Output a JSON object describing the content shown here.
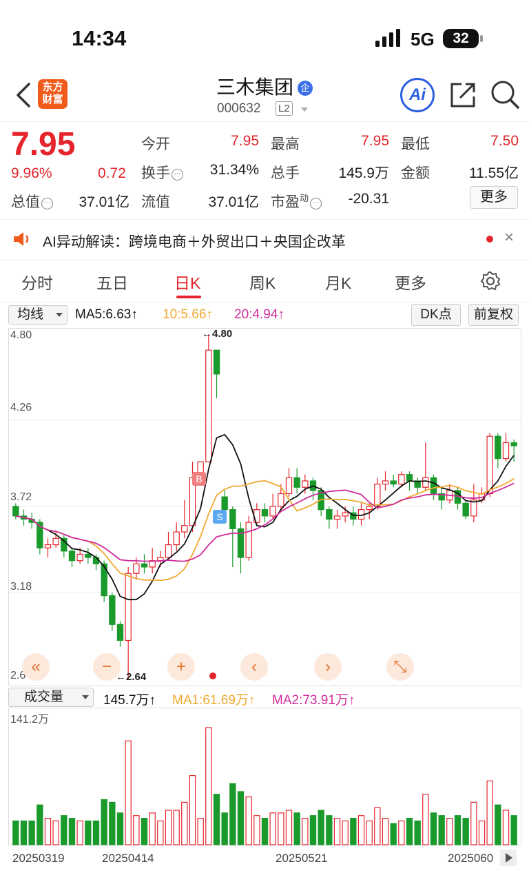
{
  "status": {
    "time": "14:34",
    "network": "5G",
    "battery": "32"
  },
  "header": {
    "logo_line1": "东方",
    "logo_line2": "财富",
    "title": "三木集团",
    "badge": "企",
    "code": "000632",
    "level": "L2",
    "ai_label": "Ai"
  },
  "quote": {
    "price": "7.95",
    "pct": "9.96%",
    "change": "0.72",
    "open_label": "今开",
    "open": "7.95",
    "high_label": "最高",
    "high": "7.95",
    "low_label": "最低",
    "low": "7.50",
    "turnover_label": "换手",
    "turnover": "31.34%",
    "volume_label": "总手",
    "volume": "145.9万",
    "amount_label": "金额",
    "amount": "11.55亿",
    "mktcap_label": "总值",
    "mktcap": "37.01亿",
    "float_label": "流值",
    "float": "37.01亿",
    "pe_label": "市盈",
    "pe_sup": "动",
    "pe": "-20.31",
    "more": "更多"
  },
  "ai_news": {
    "text": "AI异动解读：跨境电商＋外贸出口＋央国企改革",
    "close": "×"
  },
  "tabs": [
    {
      "label": "分时"
    },
    {
      "label": "五日"
    },
    {
      "label": "日K"
    },
    {
      "label": "周K"
    },
    {
      "label": "月K"
    },
    {
      "label": "更多"
    }
  ],
  "ma_bar": {
    "select": "均线",
    "ma5": "MA5:6.63↑",
    "ma10": "10:5.66↑",
    "ma20": "20:4.94↑",
    "dk": "DK点",
    "fq": "前复权"
  },
  "kline": {
    "y_labels": [
      "4.80",
      "4.26",
      "3.72",
      "3.18",
      "2.64"
    ],
    "max_label": "←4.80",
    "min_label": "←2.64",
    "buy": "B",
    "sell": "S",
    "controls": [
      "«",
      "−",
      "+",
      "‹",
      "›",
      "⤡"
    ]
  },
  "volume": {
    "select": "成交量",
    "vol": "145.7万↑",
    "ma1": "MA1:61.69万↑",
    "ma2": "MA2:73.91万↑",
    "max_label": "141.2万"
  },
  "dates": [
    "20250319",
    "20250414",
    "20250521",
    "2025060"
  ],
  "colors": {
    "up": "#e5242b",
    "down": "#1b9a2c",
    "ma5": "#111111",
    "ma10": "#f0a830",
    "ma20": "#d02a9a"
  },
  "chart_data": {
    "type": "candlestick",
    "y_range": [
      2.64,
      4.8
    ],
    "candles": [
      [
        3.72,
        3.66,
        3.74,
        3.64
      ],
      [
        3.66,
        3.64,
        3.7,
        3.6
      ],
      [
        3.64,
        3.62,
        3.68,
        3.58
      ],
      [
        3.62,
        3.46,
        3.64,
        3.42
      ],
      [
        3.46,
        3.48,
        3.52,
        3.4
      ],
      [
        3.48,
        3.52,
        3.56,
        3.46
      ],
      [
        3.52,
        3.44,
        3.54,
        3.4
      ],
      [
        3.44,
        3.38,
        3.46,
        3.34
      ],
      [
        3.38,
        3.42,
        3.46,
        3.36
      ],
      [
        3.42,
        3.4,
        3.46,
        3.36
      ],
      [
        3.4,
        3.36,
        3.42,
        3.32
      ],
      [
        3.36,
        3.16,
        3.38,
        3.12
      ],
      [
        3.16,
        2.98,
        3.18,
        2.94
      ],
      [
        2.98,
        2.88,
        3.0,
        2.84
      ],
      [
        2.88,
        3.3,
        3.34,
        2.64
      ],
      [
        3.3,
        3.36,
        3.4,
        3.26
      ],
      [
        3.36,
        3.34,
        3.42,
        3.3
      ],
      [
        3.34,
        3.38,
        3.46,
        3.3
      ],
      [
        3.38,
        3.4,
        3.44,
        3.34
      ],
      [
        3.4,
        3.48,
        3.56,
        3.38
      ],
      [
        3.48,
        3.56,
        3.62,
        3.44
      ],
      [
        3.56,
        3.6,
        3.76,
        3.52
      ],
      [
        3.6,
        3.9,
        4.0,
        3.56
      ],
      [
        3.9,
        4.0,
        4.0,
        3.88
      ],
      [
        4.0,
        4.7,
        4.8,
        4.0
      ],
      [
        4.7,
        4.55,
        4.7,
        4.4
      ],
      [
        3.78,
        3.7,
        3.82,
        3.66
      ],
      [
        3.7,
        3.58,
        3.72,
        3.34
      ],
      [
        3.58,
        3.4,
        3.62,
        3.3
      ],
      [
        3.4,
        3.62,
        3.66,
        3.38
      ],
      [
        3.62,
        3.7,
        3.74,
        3.6
      ],
      [
        3.7,
        3.66,
        3.74,
        3.62
      ],
      [
        3.66,
        3.72,
        3.8,
        3.64
      ],
      [
        3.72,
        3.8,
        3.86,
        3.7
      ],
      [
        3.8,
        3.9,
        3.96,
        3.78
      ],
      [
        3.9,
        3.84,
        3.96,
        3.8
      ],
      [
        3.84,
        3.88,
        3.92,
        3.8
      ],
      [
        3.88,
        3.82,
        3.9,
        3.76
      ],
      [
        3.82,
        3.7,
        3.84,
        3.66
      ],
      [
        3.7,
        3.64,
        3.72,
        3.58
      ],
      [
        3.64,
        3.66,
        3.7,
        3.58
      ],
      [
        3.66,
        3.68,
        3.72,
        3.62
      ],
      [
        3.68,
        3.64,
        3.72,
        3.6
      ],
      [
        3.64,
        3.7,
        3.74,
        3.6
      ],
      [
        3.7,
        3.72,
        3.74,
        3.64
      ],
      [
        3.72,
        3.86,
        3.9,
        3.7
      ],
      [
        3.86,
        3.88,
        3.94,
        3.82
      ],
      [
        3.88,
        3.86,
        3.92,
        3.84
      ],
      [
        3.86,
        3.92,
        3.94,
        3.84
      ],
      [
        3.92,
        3.88,
        3.94,
        3.82
      ],
      [
        3.88,
        3.84,
        3.9,
        3.8
      ],
      [
        3.84,
        3.9,
        4.12,
        3.82
      ],
      [
        3.9,
        3.8,
        3.92,
        3.76
      ],
      [
        3.8,
        3.76,
        3.84,
        3.7
      ],
      [
        3.76,
        3.82,
        3.86,
        3.74
      ],
      [
        3.82,
        3.74,
        3.84,
        3.7
      ],
      [
        3.74,
        3.66,
        3.76,
        3.64
      ],
      [
        3.66,
        3.76,
        3.86,
        3.62
      ],
      [
        3.76,
        3.8,
        3.84,
        3.74
      ],
      [
        3.8,
        4.16,
        4.18,
        3.78
      ],
      [
        4.16,
        4.02,
        4.18,
        3.96
      ],
      [
        4.02,
        4.12,
        4.18,
        4.0
      ],
      [
        4.12,
        4.1,
        4.14,
        4.0
      ]
    ]
  }
}
